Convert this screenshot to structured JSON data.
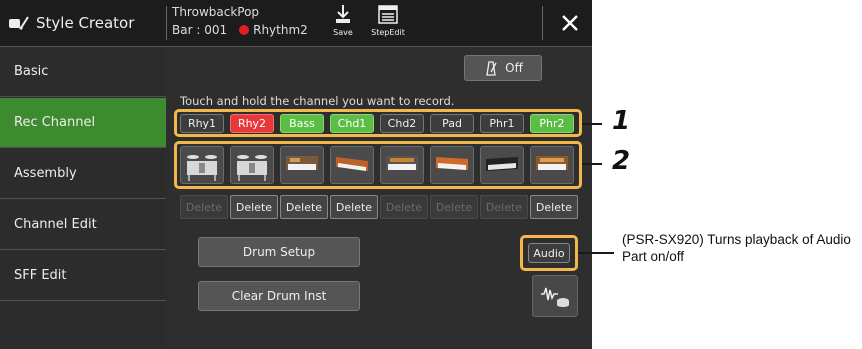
{
  "header": {
    "app_title": "Style Creator",
    "song_name": "ThrowbackPop",
    "bar_label": "Bar : 001",
    "rhythm_label": "Rhythm2",
    "save_label": "Save",
    "stepedit_label": "StepEdit",
    "close_glyph": "✕"
  },
  "sidebar": {
    "items": [
      {
        "label": "Basic"
      },
      {
        "label": "Rec Channel"
      },
      {
        "label": "Assembly"
      },
      {
        "label": "Channel Edit"
      },
      {
        "label": "SFF Edit"
      }
    ],
    "active_index": 1
  },
  "main": {
    "metronome_label": "Off",
    "instruction": "Touch and hold the channel you want to record.",
    "channels": [
      {
        "label": "Rhy1",
        "state": "off"
      },
      {
        "label": "Rhy2",
        "state": "red"
      },
      {
        "label": "Bass",
        "state": "green"
      },
      {
        "label": "Chd1",
        "state": "green"
      },
      {
        "label": "Chd2",
        "state": "off"
      },
      {
        "label": "Pad",
        "state": "off"
      },
      {
        "label": "Phr1",
        "state": "off"
      },
      {
        "label": "Phr2",
        "state": "green"
      }
    ],
    "voices": [
      "drum-kit-icon",
      "drum-kit-icon",
      "keyboard-icon",
      "keyboard-icon",
      "keyboard-icon",
      "keyboard-icon",
      "synth-icon",
      "keyboard-icon"
    ],
    "delete_buttons": [
      {
        "label": "Delete",
        "enabled": false
      },
      {
        "label": "Delete",
        "enabled": true
      },
      {
        "label": "Delete",
        "enabled": true
      },
      {
        "label": "Delete",
        "enabled": true
      },
      {
        "label": "Delete",
        "enabled": false
      },
      {
        "label": "Delete",
        "enabled": false
      },
      {
        "label": "Delete",
        "enabled": false
      },
      {
        "label": "Delete",
        "enabled": true
      }
    ],
    "drum_setup_label": "Drum Setup",
    "clear_drum_label": "Clear Drum Inst",
    "audio_label": "Audio"
  },
  "callouts": {
    "num1": "1",
    "num2": "2",
    "audio_note": "(PSR-SX920) Turns playback of Audio Part on/off"
  },
  "colors": {
    "active_green": "#3e8a2e",
    "channel_green": "#5cbd44",
    "channel_red": "#e8393a",
    "highlight_orange": "#f2b84b"
  }
}
